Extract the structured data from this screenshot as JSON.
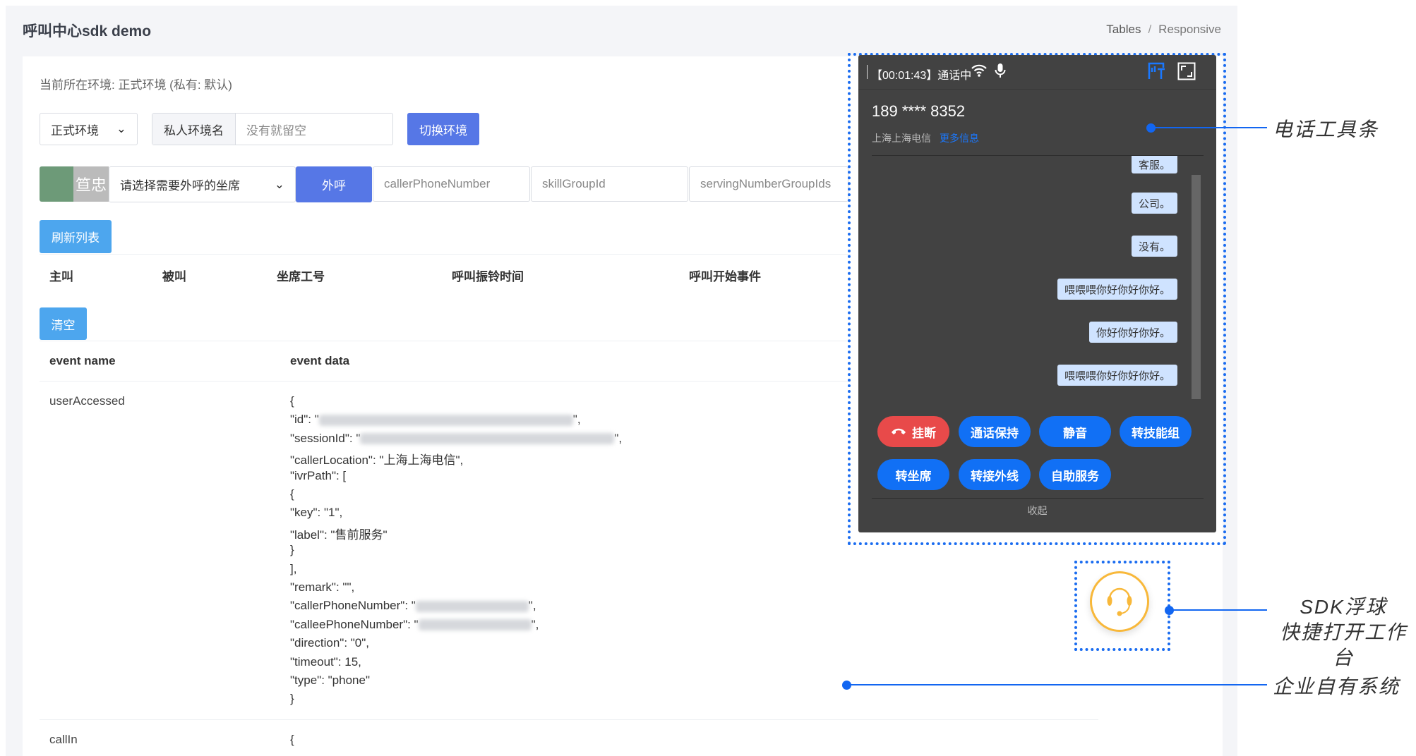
{
  "header": {
    "title": "呼叫中心sdk demo",
    "breadcrumb": [
      "Tables",
      "Responsive"
    ],
    "breadcrumb_sep": "/"
  },
  "env": {
    "current": "当前所在环境: 正式环境 (私有: 默认)",
    "select_value": "正式环境",
    "private_label": "私人环境名",
    "private_placeholder": "没有就留空",
    "switch_button": "切换环境"
  },
  "call": {
    "avatar_text": "笪忠",
    "seat_select": "请选择需要外呼的坐席",
    "call_button": "外呼",
    "caller_placeholder": "callerPhoneNumber",
    "skill_placeholder": "skillGroupId",
    "serving_placeholder": "servingNumberGroupIds"
  },
  "list": {
    "refresh_button": "刷新列表",
    "columns": [
      "主叫",
      "被叫",
      "坐席工号",
      "呼叫振铃时间",
      "呼叫开始事件"
    ]
  },
  "events": {
    "clear_button": "清空",
    "columns": [
      "event name",
      "event data"
    ],
    "rows": [
      {
        "name": "userAccessed",
        "lines": [
          {
            "t": "{"
          },
          {
            "t": "\"id\": \"",
            "mask": true,
            "post": "\","
          },
          {
            "t": "\"sessionId\": \"",
            "mask": true,
            "post": "\","
          },
          {
            "t": "\"callerLocation\": \"上海上海电信\","
          },
          {
            "t": "\"ivrPath\": ["
          },
          {
            "t": "{"
          },
          {
            "t": "\"key\": \"1\","
          },
          {
            "t": "\"label\": \"售前服务\""
          },
          {
            "t": "}"
          },
          {
            "t": "],"
          },
          {
            "t": "\"remark\": \"\","
          },
          {
            "t": "\"callerPhoneNumber\": \"",
            "mask": true,
            "post": "\","
          },
          {
            "t": "\"calleePhoneNumber\": \"",
            "mask": true,
            "post": "\","
          },
          {
            "t": "\"direction\": \"0\","
          },
          {
            "t": "\"timeout\": 15,"
          },
          {
            "t": "\"type\": \"phone\""
          },
          {
            "t": "}"
          }
        ]
      },
      {
        "name": "callIn",
        "lines": [
          {
            "t": "{"
          }
        ]
      }
    ]
  },
  "phone": {
    "timer": "【00:01:43】通话中",
    "number": "189 **** 8352",
    "location": "上海上海电信",
    "more_info": "更多信息",
    "messages": [
      "客服。",
      "公司。",
      "没有。",
      "喂喂喂你好你好你好。",
      "你好你好你好。",
      "喂喂喂你好你好你好。"
    ],
    "buttons": [
      "挂断",
      "通话保持",
      "静音",
      "转技能组",
      "转坐席",
      "转接外线",
      "自助服务"
    ],
    "collapse": "收起"
  },
  "annotations": {
    "toolbar": "电话工具条",
    "ball_line1": "SDK浮球",
    "ball_line2": "快捷打开工作台",
    "system": "企业自有系统"
  },
  "colors": {
    "primary": "#5677e6",
    "light_blue": "#4da6ee",
    "phone_blue": "#1170f5",
    "hangup": "#e84a4a",
    "ball": "#f8b83a"
  }
}
